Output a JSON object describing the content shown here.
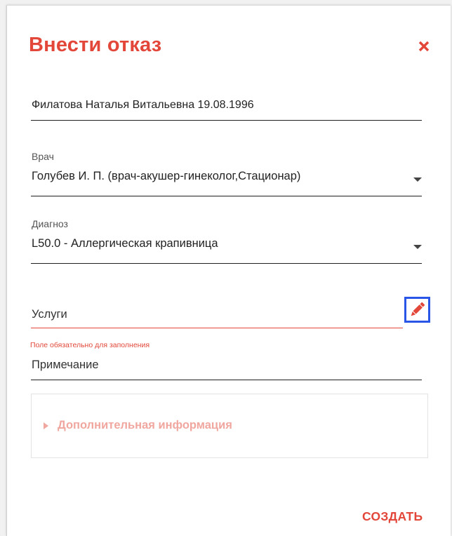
{
  "dialog": {
    "title": "Внести отказ",
    "close_icon": "close-icon"
  },
  "patient": {
    "value": "Филатова Наталья Витальевна 19.08.1996"
  },
  "doctor": {
    "label": "Врач",
    "value": "Голубев И. П. (врач-акушер-гинеколог,Стационар)"
  },
  "diagnosis": {
    "label": "Диагноз",
    "value": "L50.0 - Аллергическая крапивница"
  },
  "services": {
    "placeholder": "Услуги",
    "error": "Поле обязательно для заполнения",
    "edit_icon": "pencil-icon"
  },
  "note": {
    "placeholder": "Примечание"
  },
  "additional": {
    "label": "Дополнительная информация"
  },
  "actions": {
    "create_label": "СОЗДАТЬ"
  },
  "colors": {
    "accent": "#e2473a",
    "focus_outline": "#2a56e8",
    "muted_accent": "#f0a79f"
  }
}
